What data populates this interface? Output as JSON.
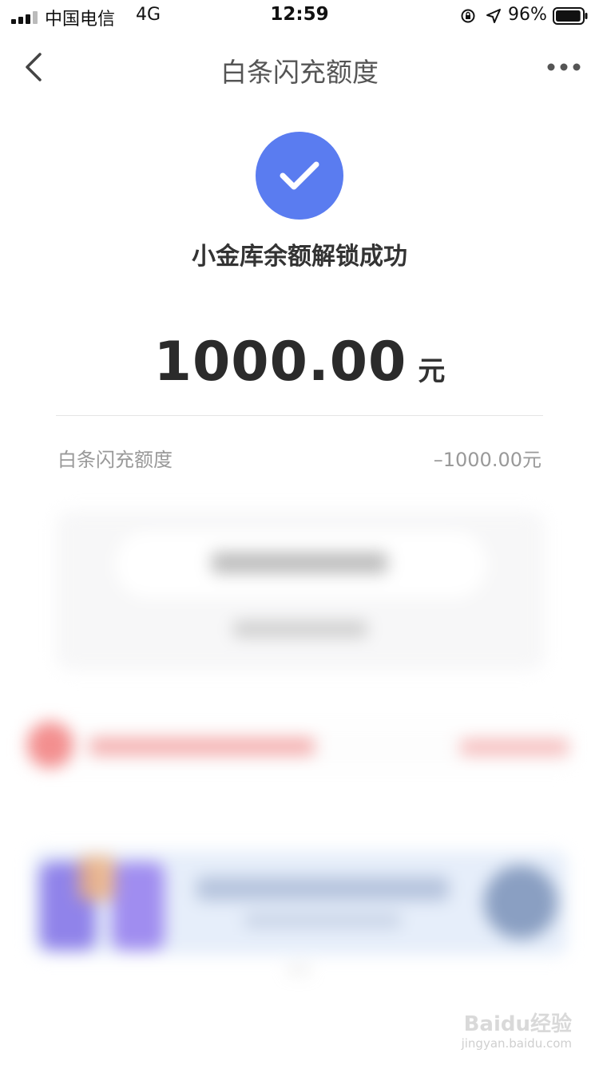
{
  "status_bar": {
    "carrier": "中国电信",
    "network": "4G",
    "time": "12:59",
    "battery": "96%",
    "battery_level": 0.96
  },
  "nav": {
    "title": "白条闪充额度",
    "back_icon": "chevron-left-icon",
    "more_icon": "more-dots-icon"
  },
  "result": {
    "icon": "check-circle-icon",
    "icon_color": "#5a7cf0",
    "message": "小金库余额解锁成功",
    "amount": "1000.00",
    "unit": "元"
  },
  "detail": {
    "label": "白条闪充额度",
    "value": "–1000.00元"
  },
  "watermark": {
    "logo": "Baidu经验",
    "url": "jingyan.baidu.com"
  }
}
